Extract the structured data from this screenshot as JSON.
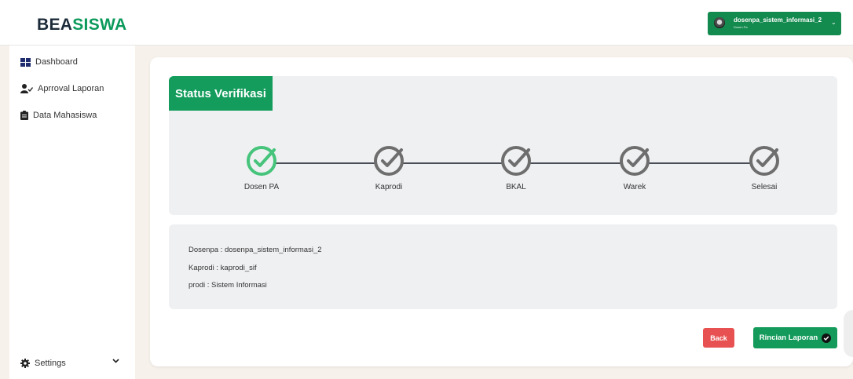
{
  "brand": {
    "part1": "BEA",
    "part2": "SISWA"
  },
  "user_menu": {
    "username": "dosenpa_sistem_informasi_2",
    "role": "Dosen Pa",
    "caret_icon": "chevron-down-icon"
  },
  "sidebar": {
    "items": [
      {
        "label": "Dashboard",
        "icon": "dashboard-grid-icon"
      },
      {
        "label": "Aprroval Laporan",
        "icon": "user-check-icon"
      },
      {
        "label": "Data Mahasiswa",
        "icon": "clipboard-icon"
      }
    ],
    "settings": {
      "label": "Settings",
      "icon": "gear-icon"
    }
  },
  "status": {
    "title": "Status Verifikasi",
    "steps": [
      {
        "label": "Dosen PA",
        "done": true
      },
      {
        "label": "Kaprodi",
        "done": false
      },
      {
        "label": "BKAL",
        "done": false
      },
      {
        "label": "Warek",
        "done": false
      },
      {
        "label": "Selesai",
        "done": false
      }
    ]
  },
  "info": {
    "dosenpa": "Dosenpa : dosenpa_sistem_informasi_2",
    "kaprodi": "Kaprodi : kaprodi_sif",
    "prodi": "prodi : Sistem Informasi"
  },
  "actions": {
    "back_label": "Back",
    "rincian_label": "Rincian Laporan"
  },
  "colors": {
    "brand_green": "#139c5c",
    "done_step": "#46c47b",
    "pending_step": "#6e6e6e",
    "back_red": "#e85151"
  }
}
